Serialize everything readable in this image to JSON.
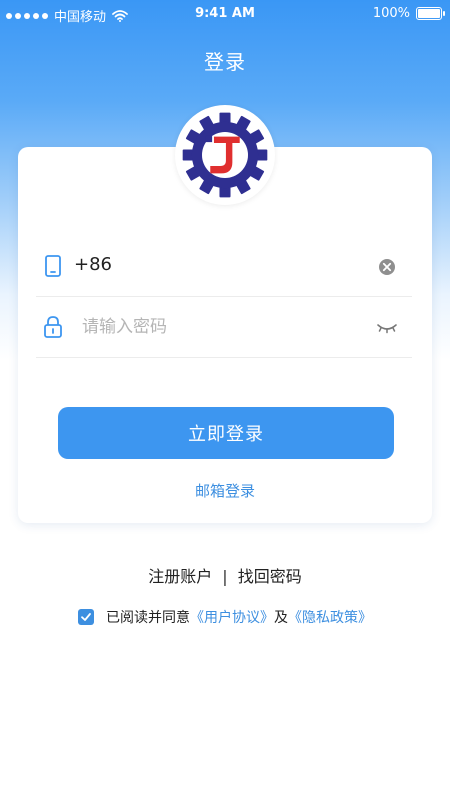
{
  "status_bar": {
    "carrier": "中国移动",
    "time": "9:41 AM",
    "battery": "100%"
  },
  "header": {
    "title": "登录"
  },
  "logo": {
    "letter": "J",
    "gear_color": "#2f2f91",
    "letter_color": "#e02f2f"
  },
  "form": {
    "phone": {
      "prefix": "+86",
      "value": ""
    },
    "password": {
      "placeholder": "请输入密码"
    },
    "login_button": "立即登录",
    "email_login": "邮箱登录"
  },
  "footer_links": {
    "register": "注册账户",
    "separator": "|",
    "recover": "找回密码"
  },
  "agreement": {
    "checked": true,
    "text": "已阅读并同意",
    "user_agreement": "《用户协议》",
    "and": "及",
    "privacy_policy": "《隐私政策》"
  },
  "colors": {
    "accent": "#3d96f0",
    "link": "#3d8fe0"
  }
}
